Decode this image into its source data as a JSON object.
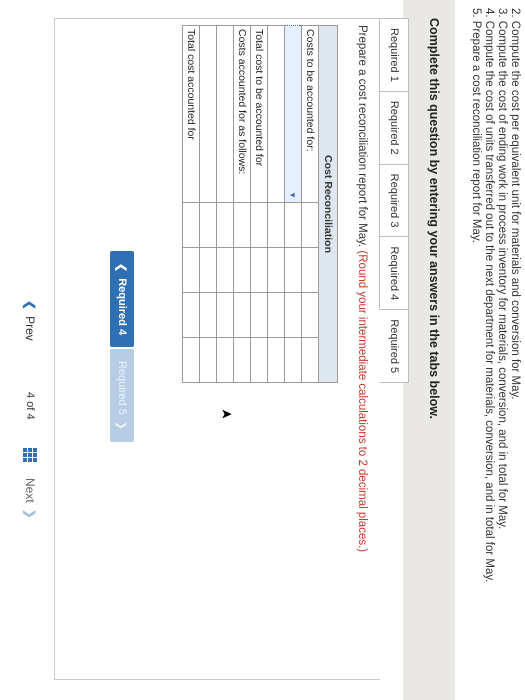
{
  "intro_lines": [
    "2. Compute the cost per equivalent unit for materials and conversion for May.",
    "3. Compute the cost of ending work in process inventory for materials, conversion, and in total for May.",
    "4. Compute the cost of units transferred out to the next department for materials, conversion, and in total for May.",
    "5. Prepare a cost reconciliation report for May."
  ],
  "band_title": "Complete this question by entering your answers in the tabs below.",
  "tabs": [
    {
      "label": "Required 1"
    },
    {
      "label": "Required 2"
    },
    {
      "label": "Required 3"
    },
    {
      "label": "Required 4"
    },
    {
      "label": "Required 5",
      "active": true
    }
  ],
  "instruction": {
    "main": "Prepare a cost reconciliation report for May.",
    "note": "(Round your intermediate calculations to 2 decimal places.)"
  },
  "table": {
    "header": "Cost Reconciliation",
    "rows": {
      "costs_to_be_accounted_for": "Costs to be accounted for:",
      "total_cost_to_be_accounted_for": "Total cost to be accounted for",
      "costs_accounted_for_as_follows": "Costs accounted for as follows:",
      "total_cost_accounted_for": "Total cost accounted for"
    }
  },
  "buttons": {
    "prev_required": "Required 4",
    "next_required": "Required 5"
  },
  "footer": {
    "prev": "Prev",
    "page_current": "4",
    "page_of": "of",
    "page_total": "4",
    "next": "Next"
  }
}
